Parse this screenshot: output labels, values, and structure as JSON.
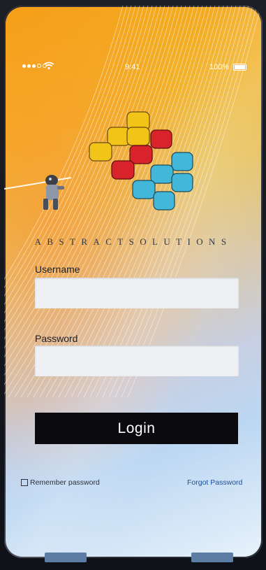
{
  "status_bar": {
    "time": "9:41",
    "battery": "100%",
    "signal_icon": "signal-dots-icon",
    "wifi_icon": "wifi-icon",
    "battery_icon": "battery-icon"
  },
  "brand": {
    "name": "ABSTRACTSOLUTIONS",
    "logo_icon": "pixel-blocks-logo",
    "logo_colors": [
      "#f2c417",
      "#d8232a",
      "#43b7d9"
    ]
  },
  "form": {
    "username_label": "Username",
    "username_value": "",
    "password_label": "Password",
    "password_value": "",
    "login_label": "Login",
    "remember_label": "Remember password",
    "remember_checked": false,
    "forgot_label": "Forgot Password"
  },
  "colors": {
    "button_bg": "#0b0b0f",
    "link": "#1d4f9a",
    "field_bg": "#eef0f3"
  }
}
